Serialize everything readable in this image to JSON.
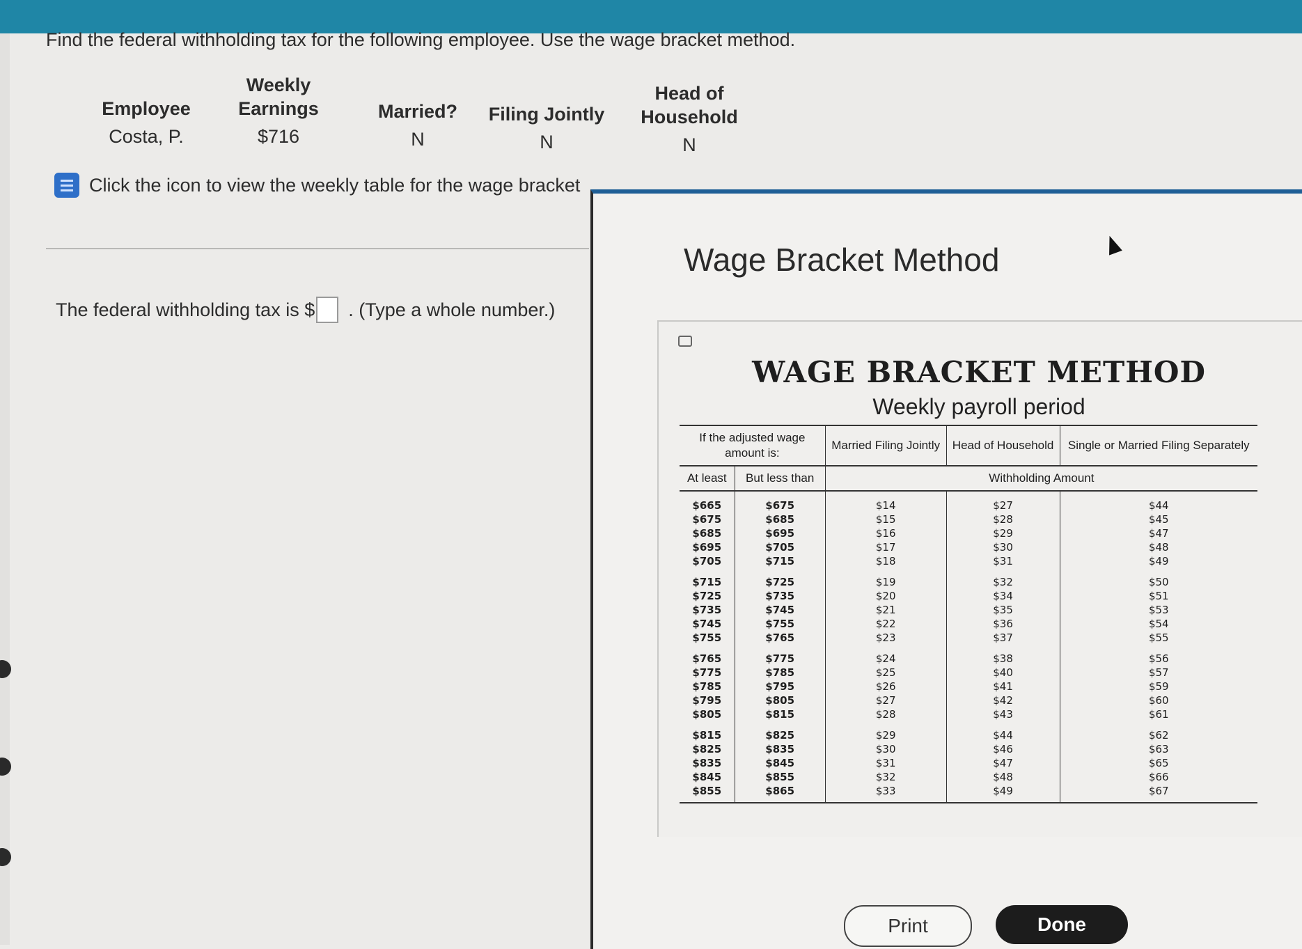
{
  "question": "Find the federal withholding tax for the following employee. Use the wage bracket method.",
  "employee_table": {
    "headers": {
      "employee": "Employee",
      "weekly_line1": "Weekly",
      "weekly_line2": "Earnings",
      "married": "Married?",
      "filing_jointly": "Filing Jointly",
      "head_line1": "Head of",
      "head_line2": "Household"
    },
    "row": {
      "employee": "Costa, P.",
      "weekly_earnings": "$716",
      "married": "N",
      "filing_jointly": "N",
      "head_of_household": "N"
    }
  },
  "hint": {
    "icon": "book-icon",
    "text": "Click the icon to view the weekly table for the wage bracket"
  },
  "answer": {
    "prefix": "The federal withholding tax is $",
    "suffix": ". (Type a whole number.)",
    "value": ""
  },
  "popup": {
    "title": "Wage Bracket Method",
    "table_title": "WAGE BRACKET METHOD",
    "table_subtitle": "Weekly payroll period",
    "col_headers": {
      "adjusted_wage": "If the adjusted wage amount is:",
      "married_filing_jointly": "Married Filing Jointly",
      "head_of_household": "Head of Household",
      "single_or_married_sep": "Single or Married Filing Separately",
      "at_least": "At least",
      "but_less_than": "But less than",
      "withholding_amount": "Withholding Amount"
    },
    "rows": [
      [
        "$665",
        "$675",
        "$14",
        "$27",
        "$44"
      ],
      [
        "$675",
        "$685",
        "$15",
        "$28",
        "$45"
      ],
      [
        "$685",
        "$695",
        "$16",
        "$29",
        "$47"
      ],
      [
        "$695",
        "$705",
        "$17",
        "$30",
        "$48"
      ],
      [
        "$705",
        "$715",
        "$18",
        "$31",
        "$49"
      ],
      [
        "$715",
        "$725",
        "$19",
        "$32",
        "$50"
      ],
      [
        "$725",
        "$735",
        "$20",
        "$34",
        "$51"
      ],
      [
        "$735",
        "$745",
        "$21",
        "$35",
        "$53"
      ],
      [
        "$745",
        "$755",
        "$22",
        "$36",
        "$54"
      ],
      [
        "$755",
        "$765",
        "$23",
        "$37",
        "$55"
      ],
      [
        "$765",
        "$775",
        "$24",
        "$38",
        "$56"
      ],
      [
        "$775",
        "$785",
        "$25",
        "$40",
        "$57"
      ],
      [
        "$785",
        "$795",
        "$26",
        "$41",
        "$59"
      ],
      [
        "$795",
        "$805",
        "$27",
        "$42",
        "$60"
      ],
      [
        "$805",
        "$815",
        "$28",
        "$43",
        "$61"
      ],
      [
        "$815",
        "$825",
        "$29",
        "$44",
        "$62"
      ],
      [
        "$825",
        "$835",
        "$30",
        "$46",
        "$63"
      ],
      [
        "$835",
        "$845",
        "$31",
        "$47",
        "$65"
      ],
      [
        "$845",
        "$855",
        "$32",
        "$48",
        "$66"
      ],
      [
        "$855",
        "$865",
        "$33",
        "$49",
        "$67"
      ]
    ],
    "buttons": {
      "print": "Print",
      "done": "Done"
    }
  }
}
